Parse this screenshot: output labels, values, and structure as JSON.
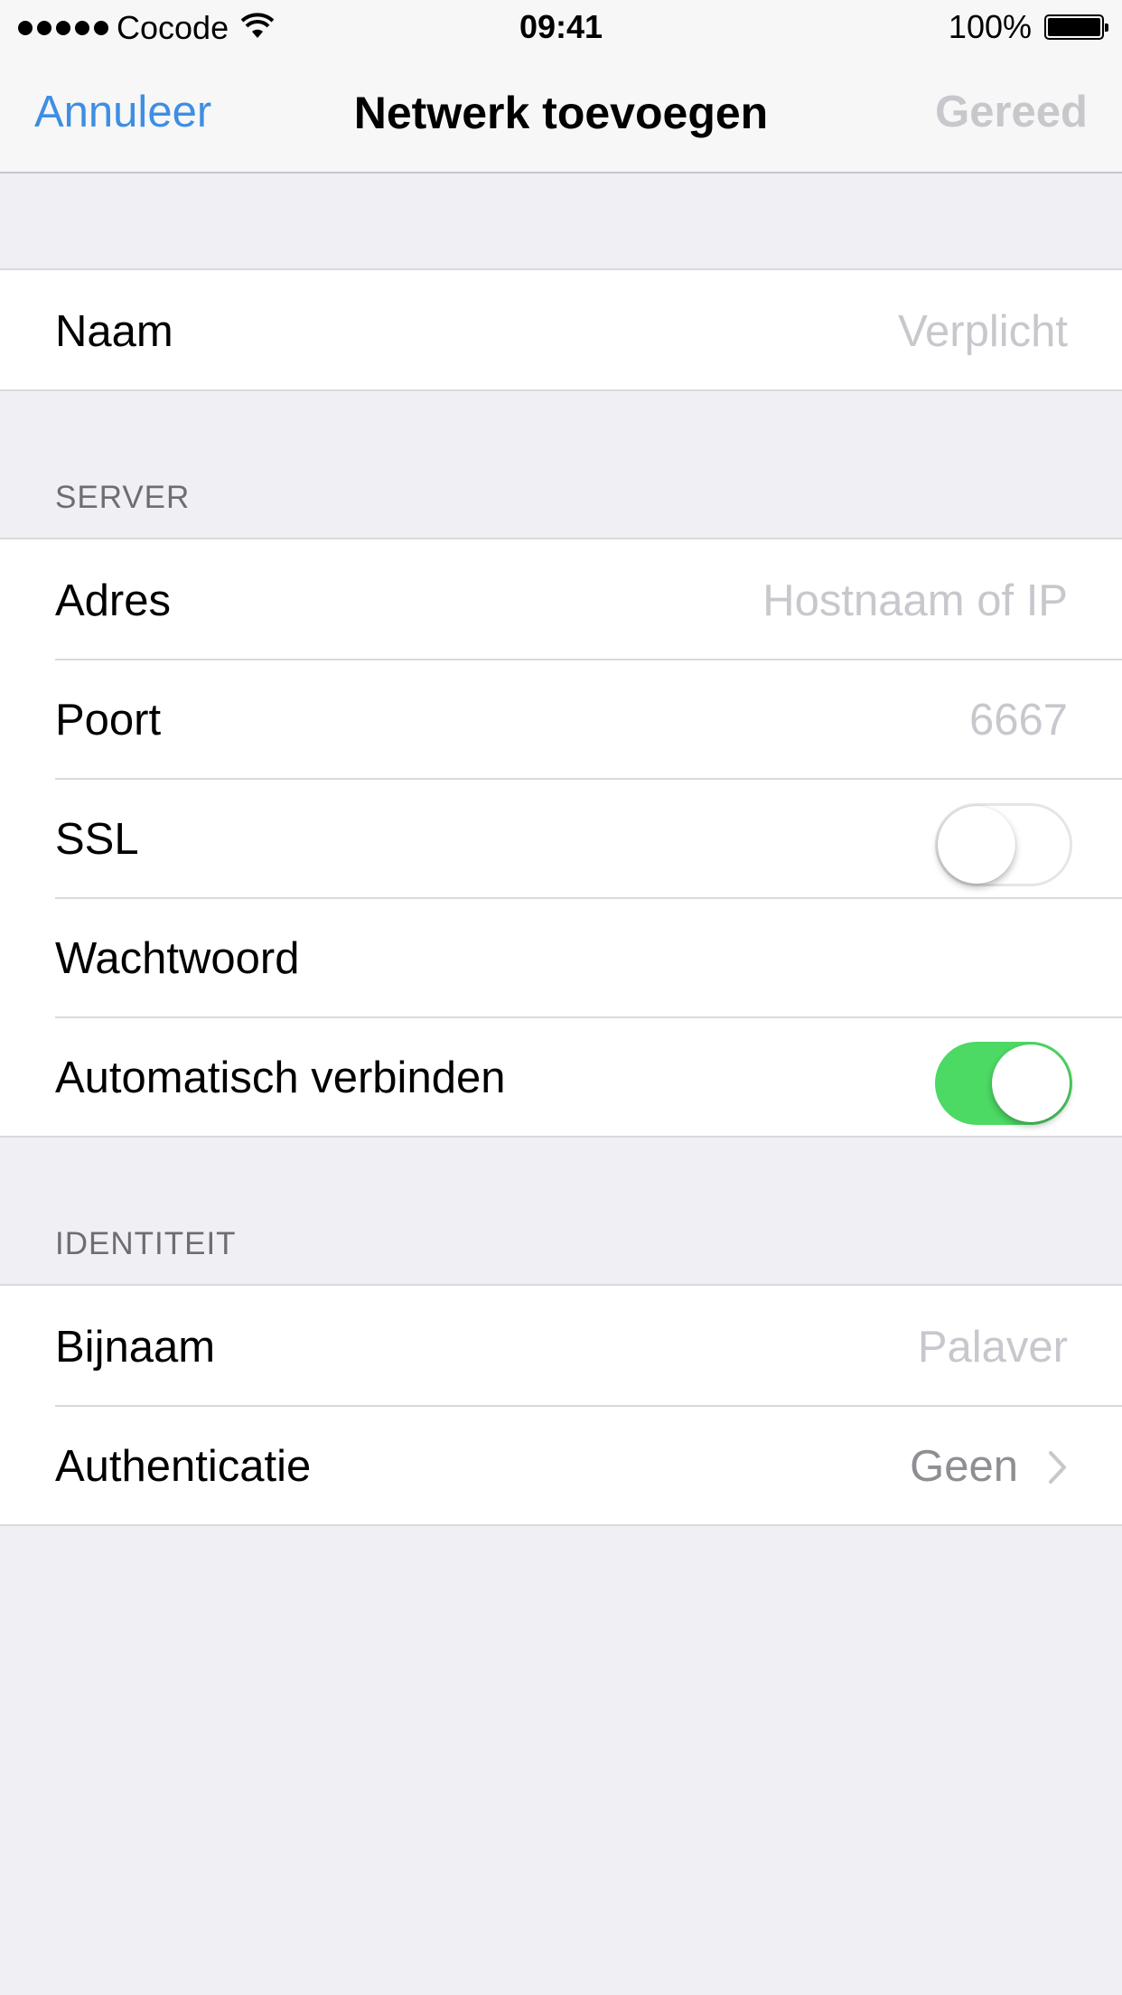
{
  "status_bar": {
    "carrier": "Cocode",
    "time": "09:41",
    "battery": "100%"
  },
  "nav": {
    "cancel_label": "Annuleer",
    "title": "Netwerk toevoegen",
    "done_label": "Gereed"
  },
  "sections": {
    "name": {
      "label": "Naam",
      "placeholder": "Verplicht"
    },
    "server": {
      "header": "SERVER",
      "address_label": "Adres",
      "address_placeholder": "Hostnaam of IP",
      "port_label": "Poort",
      "port_placeholder": "6667",
      "ssl_label": "SSL",
      "ssl_on": false,
      "password_label": "Wachtwoord",
      "autoconnect_label": "Automatisch verbinden",
      "autoconnect_on": true
    },
    "identity": {
      "header": "IDENTITEIT",
      "nickname_label": "Bijnaam",
      "nickname_placeholder": "Palaver",
      "auth_label": "Authenticatie",
      "auth_value": "Geen"
    }
  },
  "colors": {
    "accent": "#3e8ee3",
    "switch_on": "#4cd964",
    "background": "#efeff4",
    "placeholder": "#c7c7cd"
  }
}
